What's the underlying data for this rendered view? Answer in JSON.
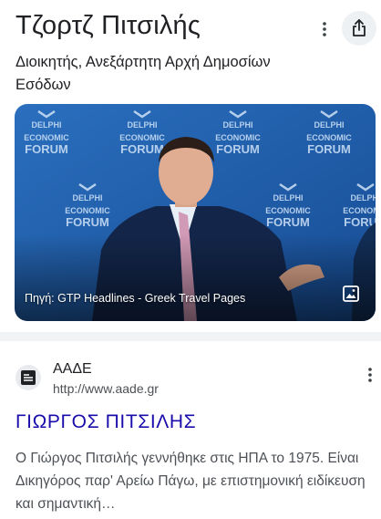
{
  "knowledge_panel": {
    "title": "Τζορτζ Πιτσιλής",
    "subtitle": "Διοικητής, Ανεξάρτητη Αρχή Δημοσίων Εσόδων",
    "image_source": "Πηγή: GTP Headlines - Greek Travel Pages",
    "backdrop_text": [
      "DELPHI",
      "ECONOMIC",
      "FORUM"
    ],
    "icons": {
      "more": "more-vert-icon",
      "share": "share-icon",
      "image": "image-icon"
    }
  },
  "result": {
    "site_name": "ΑΑΔΕ",
    "url": "http://www.aade.gr",
    "title": "ΓΙΩΡΓΟΣ ΠΙΤΣΙΛΗΣ",
    "snippet": "Ο Γιώργος Πιτσιλής γεννήθηκε στις ΗΠΑ το 1975. Είναι Δικηγόρος παρ' Αρείω Πάγω, με επιστημονική ειδίκευση και σημαντική…",
    "icons": {
      "favicon": "aade-logo-icon",
      "more": "more-vert-icon"
    }
  },
  "colors": {
    "link": "#1a0dab",
    "text": "#202124",
    "secondary_text": "#4d5156",
    "divider": "#f1f3f4",
    "backdrop": "#1f5fae"
  }
}
